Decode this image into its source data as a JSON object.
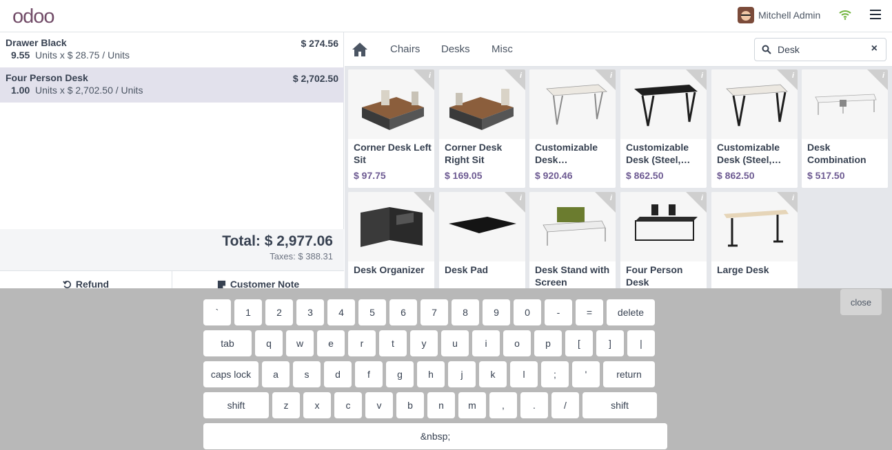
{
  "header": {
    "logo_text": "odoo",
    "user_name": "Mitchell Admin"
  },
  "order": {
    "lines": [
      {
        "name": "Drawer Black",
        "qty": "9.55",
        "unit_desc": "Units x $ 28.75 / Units",
        "price": "$ 274.56"
      },
      {
        "name": "Four Person Desk",
        "qty": "1.00",
        "unit_desc": "Units x $ 2,702.50 / Units",
        "price": "$ 2,702.50"
      }
    ],
    "total": "Total: $ 2,977.06",
    "taxes": "Taxes: $ 388.31",
    "refund_label": "Refund",
    "note_label": "Customer Note"
  },
  "categories": [
    "Chairs",
    "Desks",
    "Misc"
  ],
  "search": {
    "value": "Desk",
    "clear": "×"
  },
  "products": [
    {
      "name": "Corner Desk Left Sit",
      "price": "$ 97.75"
    },
    {
      "name": "Corner Desk Right Sit",
      "price": "$ 169.05"
    },
    {
      "name": "Customizable Desk (Aluminium, White)",
      "price": "$ 920.46"
    },
    {
      "name": "Customizable Desk (Steel, Black)",
      "price": "$ 862.50"
    },
    {
      "name": "Customizable Desk (Steel, White)",
      "price": "$ 862.50"
    },
    {
      "name": "Desk Combination",
      "price": "$ 517.50"
    },
    {
      "name": "Desk Organizer",
      "price": ""
    },
    {
      "name": "Desk Pad",
      "price": ""
    },
    {
      "name": "Desk Stand with Screen",
      "price": ""
    },
    {
      "name": "Four Person Desk",
      "price": ""
    },
    {
      "name": "Large Desk",
      "price": ""
    }
  ],
  "info_glyph": "i",
  "keyboard": {
    "close_label": "close",
    "row1": [
      "`",
      "1",
      "2",
      "3",
      "4",
      "5",
      "6",
      "7",
      "8",
      "9",
      "0",
      "-",
      "=",
      "delete"
    ],
    "row2": [
      "tab",
      "q",
      "w",
      "e",
      "r",
      "t",
      "y",
      "u",
      "i",
      "o",
      "p",
      "[",
      "]",
      "|"
    ],
    "row3": [
      "caps lock",
      "a",
      "s",
      "d",
      "f",
      "g",
      "h",
      "j",
      "k",
      "l",
      ";",
      "'",
      "return"
    ],
    "row4": [
      "shift",
      "z",
      "x",
      "c",
      "v",
      "b",
      "n",
      "m",
      ",",
      ".",
      "/",
      "shift"
    ],
    "space_label": "&nbsp;"
  },
  "colors": {
    "brand": "#714b67",
    "price": "#6d5a92",
    "selected_line": "#e2e1ec",
    "keyboard_bg": "#b8b8b8"
  }
}
